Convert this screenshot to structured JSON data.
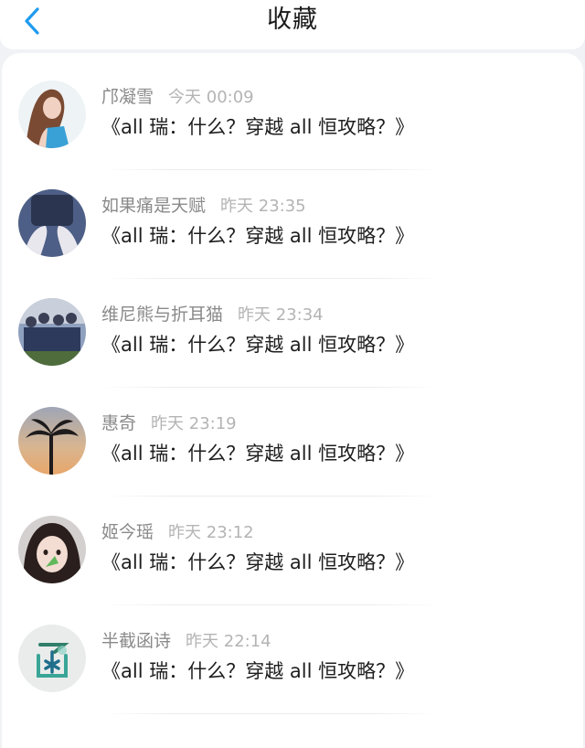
{
  "header": {
    "title": "收藏",
    "back_icon": "chevron-left-icon",
    "accent_color": "#1e9bf0"
  },
  "favorites": [
    {
      "sender": "邝凝雪",
      "time": "今天 00:09",
      "title": "《all 瑞：什么？穿越 all 恒攻略？》",
      "avatar": "avatar-girl-blue-top"
    },
    {
      "sender": "如果痛是天赋",
      "time": "昨天 23:35",
      "title": "《all 瑞：什么？穿越 all 恒攻略？》",
      "avatar": "avatar-hands-dark"
    },
    {
      "sender": "维尼熊与折耳猫",
      "time": "昨天 23:34",
      "title": "《all 瑞：什么？穿越 all 恒攻略？》",
      "avatar": "avatar-group-photo"
    },
    {
      "sender": "惠奇",
      "time": "昨天 23:19",
      "title": "《all 瑞：什么？穿越 all 恒攻略？》",
      "avatar": "avatar-palm-tree-sunset"
    },
    {
      "sender": "姬今瑶",
      "time": "昨天 23:12",
      "title": "《all 瑞：什么？穿越 all 恒攻略？》",
      "avatar": "avatar-child-face"
    },
    {
      "sender": "半截函诗",
      "time": "昨天 22:14",
      "title": "《all 瑞：什么？穿越 all 恒攻略？》",
      "avatar": "avatar-calligraphy-han"
    }
  ]
}
